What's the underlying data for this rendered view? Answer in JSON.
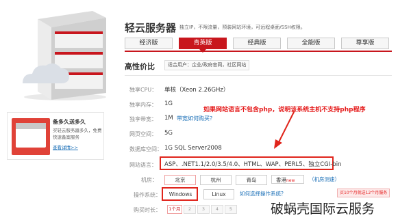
{
  "header": {
    "title": "轻云服务器",
    "subtitle": "独立IP，不限流量，预装网站环境，可远程桌面/SSH权限。"
  },
  "tabs": [
    {
      "label": "经济版",
      "active": false
    },
    {
      "label": "青英版",
      "active": true
    },
    {
      "label": "经典版",
      "active": false
    },
    {
      "label": "全能版",
      "active": false
    },
    {
      "label": "尊享版",
      "active": false
    }
  ],
  "plan": {
    "title": "高性价比",
    "badge": "适合用户：企业/政府官网，社区网站"
  },
  "promo": {
    "title": "备多久送多久",
    "desc": "买轻云服务器多久，免费快速备案服务",
    "link": "查看详情>>"
  },
  "specs": {
    "cpu": {
      "label": "独享CPU：",
      "value": "单核（Xeon 2.26GHz）"
    },
    "memory": {
      "label": "独享内存：",
      "value": "1G"
    },
    "bandwidth": {
      "label": "独享带宽：",
      "value": "1M",
      "link": "带宽如何购买？"
    },
    "web_space": {
      "label": "网页空间：",
      "value": "5G"
    },
    "db_space": {
      "label": "数据库空间：",
      "value": "1G SQL Server2008"
    },
    "language": {
      "label": "网站语言：",
      "value": "ASP、.NET1.1/2.0/3.5/4.0、HTML、WAP、PERL5、独立CGI-bin"
    }
  },
  "datacenter": {
    "label": "机房：",
    "options": [
      "北京",
      "杭州",
      "青岛",
      "香港"
    ],
    "new_tag": "new",
    "link": "（机房测速）"
  },
  "os": {
    "label": "操作系统：",
    "options": [
      "Windows",
      "Linux"
    ],
    "link": "如何选择操作系统？",
    "hint": "买10个月就送12个月服务"
  },
  "duration": {
    "label": "购买时长：",
    "steps": [
      "1个月",
      "2",
      "3",
      "4",
      "5"
    ]
  },
  "annotation": "如果网站语言不包含php，说明该系统主机不支持php程序",
  "watermark": "破蜗壳国际云服务",
  "colors": {
    "accent": "#c8161d",
    "annotation": "#e51b1b",
    "link": "#1a6fb7"
  }
}
